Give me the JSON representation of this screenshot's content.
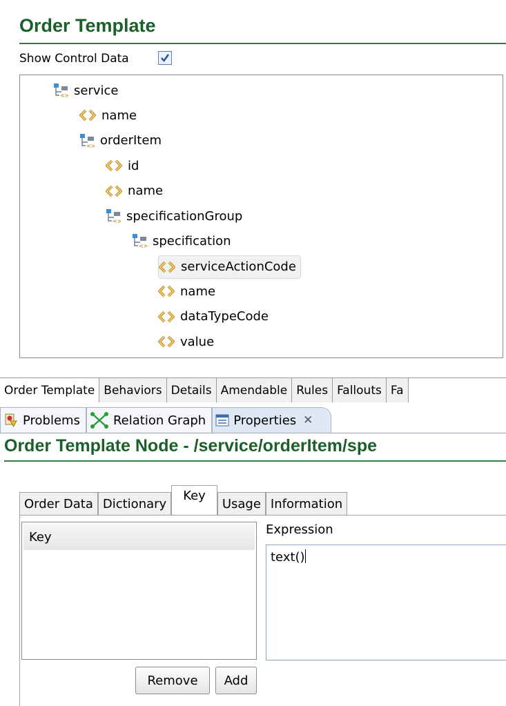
{
  "editor": {
    "title": "Order Template",
    "show_control_data_label": "Show Control Data",
    "show_control_data_checked": true
  },
  "tree": {
    "nodes": [
      {
        "label": "service",
        "type": "group",
        "level": 0
      },
      {
        "label": "name",
        "type": "element",
        "level": 1
      },
      {
        "label": "orderItem",
        "type": "group",
        "level": 1
      },
      {
        "label": "id",
        "type": "element",
        "level": 2
      },
      {
        "label": "name",
        "type": "element",
        "level": 2
      },
      {
        "label": "specificationGroup",
        "type": "group",
        "level": 2
      },
      {
        "label": "specification",
        "type": "group",
        "level": 3
      },
      {
        "label": "serviceActionCode",
        "type": "element",
        "level": 4,
        "selected": true
      },
      {
        "label": "name",
        "type": "element",
        "level": 4
      },
      {
        "label": "dataTypeCode",
        "type": "element",
        "level": 4
      },
      {
        "label": "value",
        "type": "element",
        "level": 4
      }
    ]
  },
  "editor_tabs": [
    "Order Template",
    "Behaviors",
    "Details",
    "Amendable",
    "Rules",
    "Fallouts",
    "Fa"
  ],
  "view_tabs": {
    "problems": "Problems",
    "relation_graph": "Relation Graph",
    "properties": "Properties"
  },
  "properties": {
    "title": "Order Template Node - /service/orderItem/spe",
    "tabs": [
      "Order Data",
      "Dictionary",
      "Key",
      "Usage",
      "Information"
    ],
    "active_tab": "Key",
    "key_column_header": "Key",
    "expression_label": "Expression",
    "expression_value": "text()",
    "remove_label": "Remove",
    "add_label": "Add"
  },
  "colors": {
    "heading": "#1d5f2b",
    "accent_rule": "#2e7d3e",
    "element_icon": "#c8962a",
    "group_icon": "#3a8fd0"
  }
}
